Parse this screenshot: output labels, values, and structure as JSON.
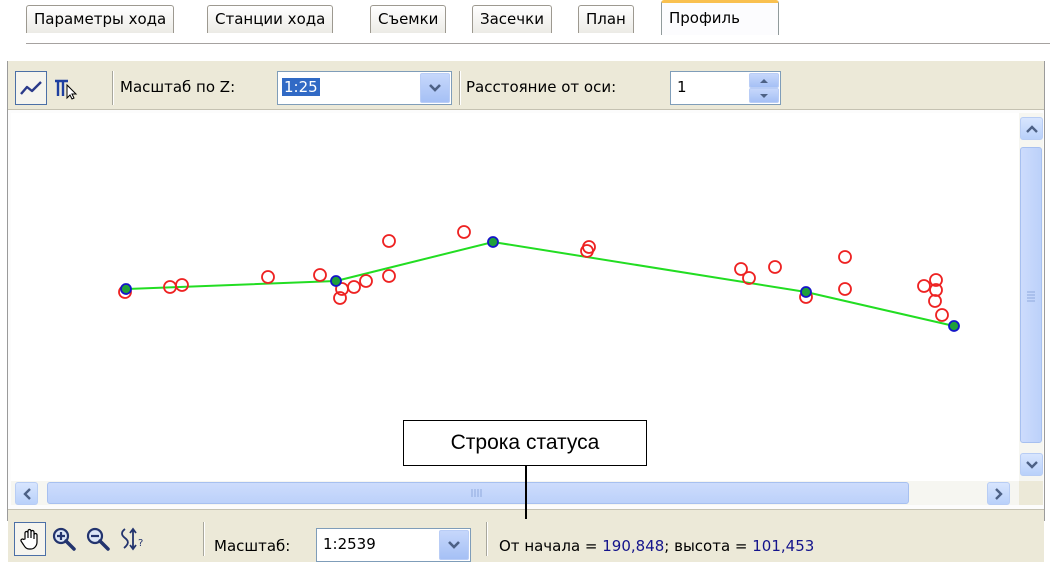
{
  "tabs": [
    {
      "label": "Параметры хода",
      "active": false
    },
    {
      "label": "Станции хода",
      "active": false
    },
    {
      "label": "Съемки",
      "active": false
    },
    {
      "label": "Засечки",
      "active": false
    },
    {
      "label": "План",
      "active": false
    },
    {
      "label": "Профиль",
      "active": true
    }
  ],
  "toolbar": {
    "line_tool_icon": "polyline-icon",
    "select_tool_icon": "profile-select-icon",
    "z_scale_label": "Масштаб по Z:",
    "z_scale_value": "1:25",
    "axis_distance_label": "Расстояние от оси:",
    "axis_distance_value": "1"
  },
  "bottom_toolbar": {
    "pan_icon": "hand-icon",
    "zoom_in_icon": "zoom-in-icon",
    "zoom_out_icon": "zoom-out-icon",
    "vertical_scale_icon": "vertical-scale-icon",
    "scale_label": "Масштаб:",
    "scale_value": "1:2539"
  },
  "status": {
    "prefix": "От начала = ",
    "distance": "190,848",
    "middle": "; высота = ",
    "height": "101,453"
  },
  "callout": {
    "label": "Строка статуса"
  },
  "colors": {
    "profile_line": "#22dd22",
    "station_fill": "#1fa03a",
    "station_stroke": "#1414c8",
    "shot_stroke": "#ee2222",
    "tab_active_accent": "#f9c04f"
  }
}
